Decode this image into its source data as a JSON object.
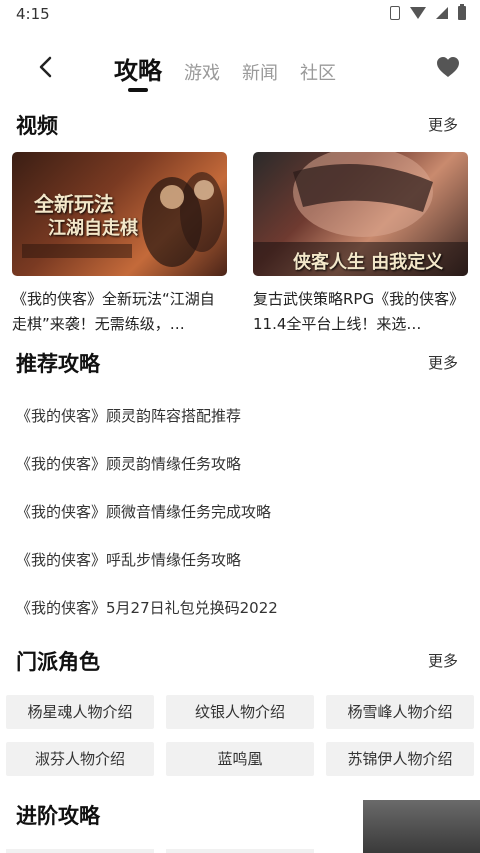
{
  "status": {
    "time": "4:15"
  },
  "nav": {
    "tabs": [
      {
        "label": "攻略",
        "active": true
      },
      {
        "label": "游戏",
        "active": false
      },
      {
        "label": "新闻",
        "active": false
      },
      {
        "label": "社区",
        "active": false
      }
    ]
  },
  "videos": {
    "title": "视频",
    "more": "更多",
    "items": [
      {
        "title": "《我的侠客》全新玩法“江湖自走棋”来袭！无需练级，…"
      },
      {
        "title": "复古武侠策略RPG《我的侠客》11.4全平台上线！来选…"
      }
    ]
  },
  "guides": {
    "title": "推荐攻略",
    "more": "更多",
    "items": [
      "《我的侠客》顾灵韵阵容搭配推荐",
      "《我的侠客》顾灵韵情缘任务攻略",
      "《我的侠客》顾微音情缘任务完成攻略",
      "《我的侠客》呼乱步情缘任务攻略",
      "《我的侠客》5月27日礼包兑换码2022"
    ]
  },
  "roles": {
    "title": "门派角色",
    "more": "更多",
    "items": [
      "杨星魂人物介绍",
      "纹银人物介绍",
      "杨雪峰人物介绍",
      "淑芬人物介绍",
      "蓝鸣凰",
      "苏锦伊人物介绍"
    ]
  },
  "advanced": {
    "title": "进阶攻略"
  },
  "colors": {
    "active_tab": "#111111",
    "inactive_tab": "#9a9a9a",
    "chip_bg": "#f1f1f1"
  }
}
